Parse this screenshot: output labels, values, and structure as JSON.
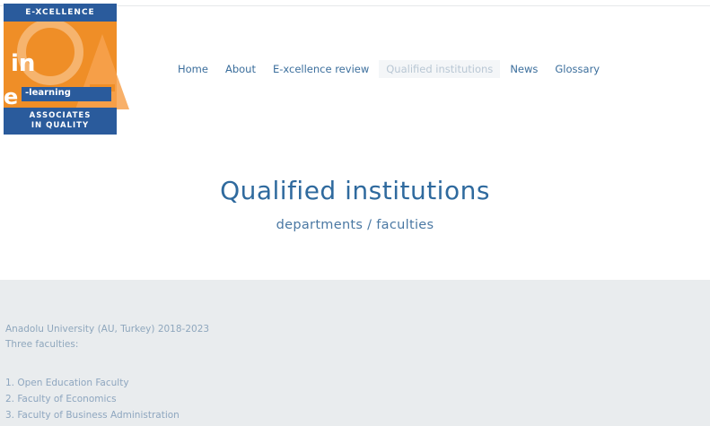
{
  "logo": {
    "top_text": "E-XCELLENCE",
    "in_text": "in",
    "e_text": "e",
    "elearning_text": "-learning",
    "bottom_line1": "ASSOCIATES",
    "bottom_line2": "IN QUALITY",
    "colors": {
      "orange": "#ef8e27",
      "blue": "#2a5b9c"
    }
  },
  "nav": {
    "items": [
      {
        "label": "Home"
      },
      {
        "label": "About"
      },
      {
        "label": "E-xcellence review"
      },
      {
        "label": "Qualified institutions"
      },
      {
        "label": "News"
      },
      {
        "label": "Glossary"
      }
    ],
    "active_index": 3
  },
  "hero": {
    "title": "Qualified institutions",
    "subtitle": "departments / faculties"
  },
  "content": {
    "institution": "Anadolu University (AU, Turkey) 2018-2023",
    "faculty_count": "Three faculties:",
    "faculties": [
      "1. Open Education Faculty",
      "2. Faculty of Economics",
      "3. Faculty of Business Administration"
    ]
  }
}
